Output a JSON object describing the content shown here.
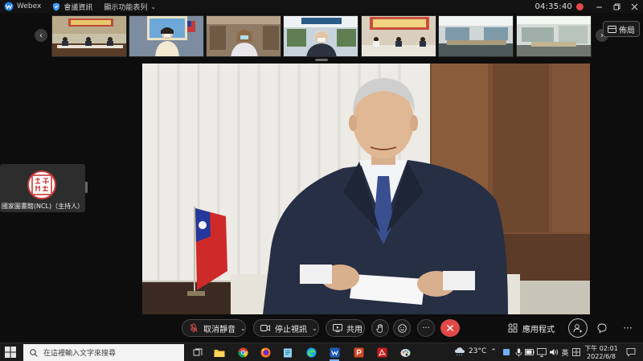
{
  "titlebar": {
    "app_name": "Webex",
    "meeting_info": "會議資訊",
    "display_menu": "顯示功能表列",
    "time": "04:35:40"
  },
  "filmstrip": {
    "layout_label": "佈局",
    "thumbnails": [
      {
        "name": "conference-room"
      },
      {
        "name": "woman-flag"
      },
      {
        "name": "woman-bookshelf"
      },
      {
        "name": "man-office"
      },
      {
        "name": "panel-table"
      },
      {
        "name": "meeting-hall"
      },
      {
        "name": "office-room"
      }
    ]
  },
  "self_view": {
    "name": "國家圖書館(NCL)（主持人）"
  },
  "controls": {
    "mute_label": "取消靜音",
    "video_label": "停止視訊",
    "share_label": "共用",
    "apps_label": "應用程式"
  },
  "taskbar": {
    "search_placeholder": "在這裡輸入文字來搜尋",
    "temperature": "23°C",
    "ime": "英",
    "clock_time": "下午 02:01",
    "clock_date": "2022/6/8"
  },
  "colors": {
    "end_call": "#e04848",
    "background": "#0d0d0d",
    "accent": "#7bb5ff"
  }
}
